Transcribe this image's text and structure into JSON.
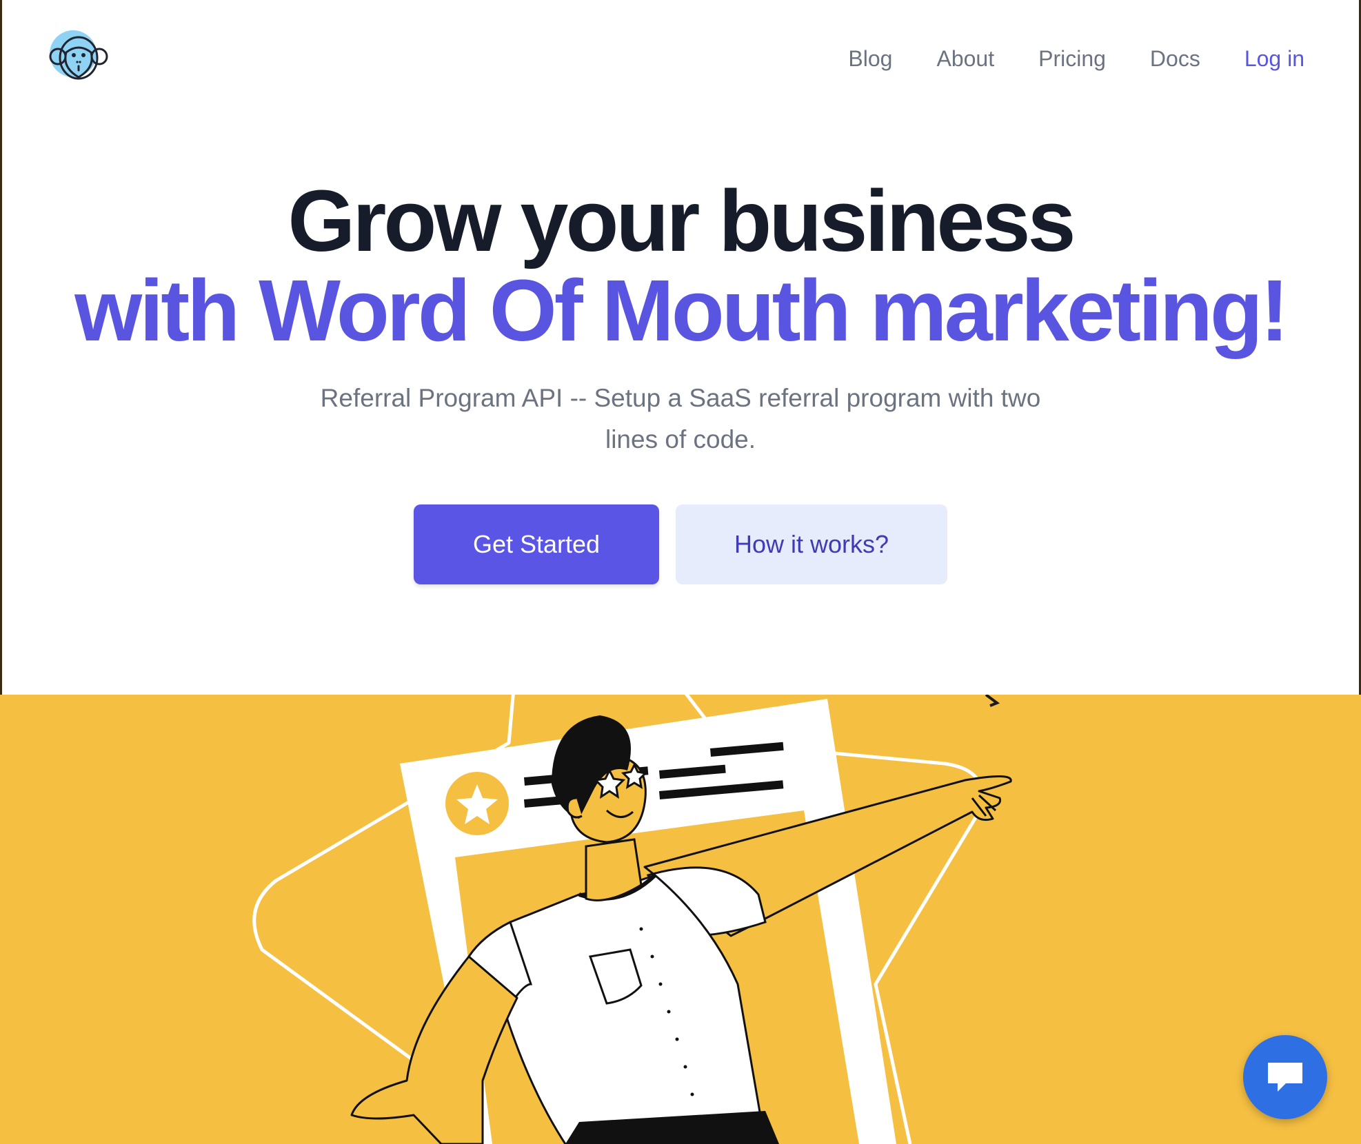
{
  "header": {
    "logo_icon": "monkey-logo-icon",
    "nav": {
      "blog": "Blog",
      "about": "About",
      "pricing": "Pricing",
      "docs": "Docs",
      "login": "Log in"
    }
  },
  "hero": {
    "title_line1": "Grow your business",
    "title_line2": "with Word Of Mouth marketing!",
    "subtitle": "Referral Program API -- Setup a SaaS referral program with two lines of code.",
    "primary_cta": "Get Started",
    "secondary_cta": "How it works?"
  },
  "illustration": {
    "icons": [
      "star-badge-icon",
      "pointing-man-illustration"
    ]
  },
  "chat": {
    "icon": "chat-bubble-icon"
  },
  "colors": {
    "accent": "#5a55e0",
    "heading": "#171c2b",
    "muted_text": "#6b7280",
    "secondary_button_bg": "#e6ecfb",
    "band_yellow": "#f5bf42",
    "chat_blue": "#2f6fe4"
  }
}
